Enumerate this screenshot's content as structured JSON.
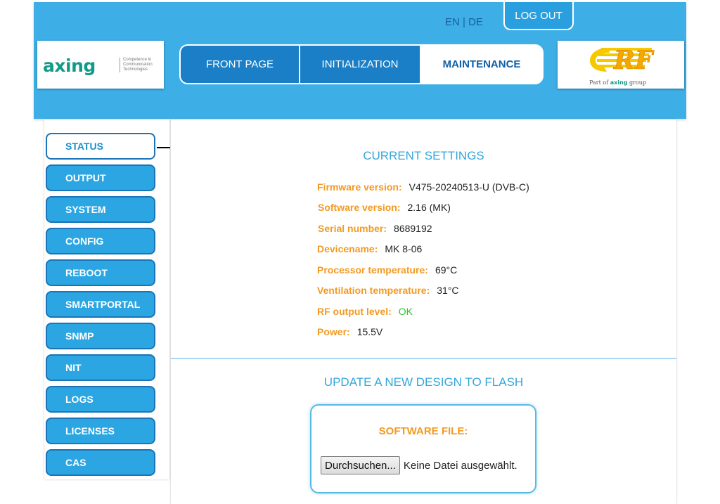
{
  "header": {
    "lang_en": "EN",
    "lang_sep": "|",
    "lang_de": "DE",
    "logout_label": "LOG OUT",
    "brand": {
      "axing_logo_text": "axing",
      "tagline": "Competence in Communication Technologies",
      "rf_logo_text": "RF",
      "rf_sub_prefix": "Part of",
      "rf_sub_brand": "axing",
      "rf_sub_suffix": "group"
    },
    "nav": {
      "front_page": "FRONT PAGE",
      "initialization": "INITIALIZATION",
      "maintenance": "MAINTENANCE"
    }
  },
  "sidebar": {
    "items": [
      {
        "label": "STATUS",
        "active": true
      },
      {
        "label": "OUTPUT"
      },
      {
        "label": "SYSTEM"
      },
      {
        "label": "CONFIG"
      },
      {
        "label": "REBOOT"
      },
      {
        "label": "SMARTPORTAL"
      },
      {
        "label": "SNMP"
      },
      {
        "label": "NIT"
      },
      {
        "label": "LOGS"
      },
      {
        "label": "LICENSES"
      },
      {
        "label": "CAS"
      }
    ]
  },
  "current_settings": {
    "title": "CURRENT SETTINGS",
    "rows": [
      {
        "label": "Firmware version:",
        "value": "V475-20240513-U (DVB-C)"
      },
      {
        "label": "Software version:",
        "value": "2.16 (MK)"
      },
      {
        "label": "Serial number:",
        "value": "8689192"
      },
      {
        "label": "Devicename:",
        "value": "MK 8-06"
      },
      {
        "label": "Processor temperature:",
        "value": "69°C"
      },
      {
        "label": "Ventilation temperature:",
        "value": "31°C"
      },
      {
        "label": "RF output level:",
        "value": "OK"
      },
      {
        "label": "Power:",
        "value": "15.5V"
      }
    ]
  },
  "update": {
    "title": "UPDATE A NEW DESIGN TO FLASH",
    "file_label": "SOFTWARE FILE:",
    "browse_label": "Durchsuchen...",
    "file_status": "Keine Datei ausgewählt."
  },
  "colors": {
    "header_bg": "#3daee6",
    "nav_active": "#1a7fc6",
    "accent_orange": "#f39a21",
    "ok_green": "#22cc22"
  }
}
